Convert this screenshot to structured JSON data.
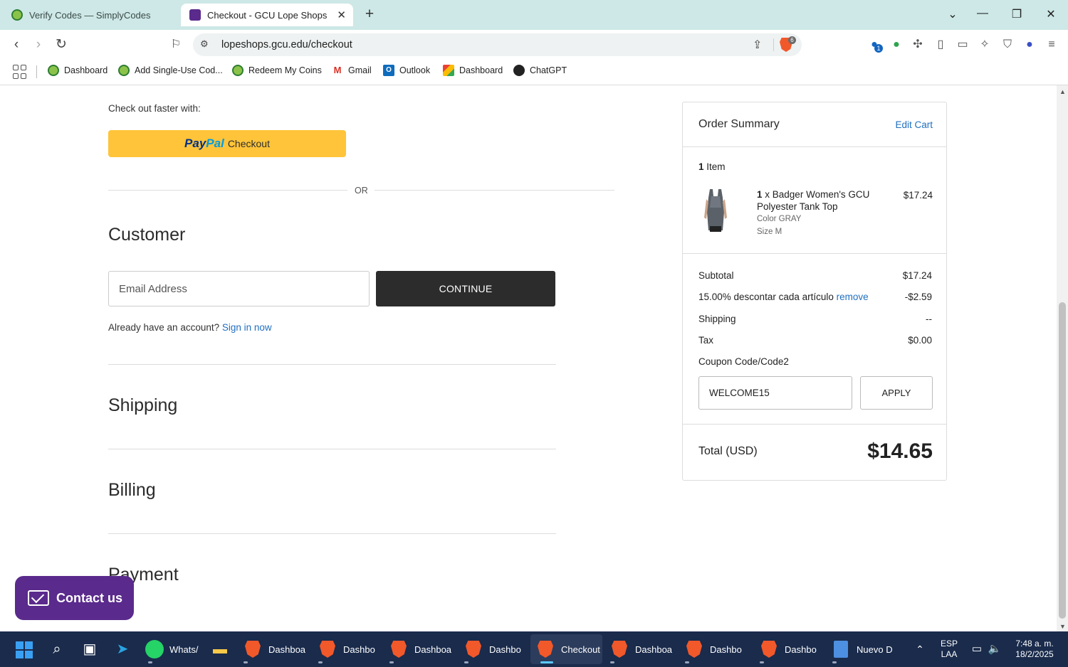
{
  "browser": {
    "tabs": [
      {
        "title": "Verify Codes — SimplyCodes",
        "active": false
      },
      {
        "title": "Checkout - GCU Lope Shops",
        "active": true
      }
    ],
    "url": "lopeshops.gcu.edu/checkout",
    "shield_count": "6",
    "ext_badge": "1",
    "bookmarks": [
      "Dashboard",
      "Add Single-Use Cod...",
      "Redeem My Coins",
      "Gmail",
      "Outlook",
      "Dashboard",
      "ChatGPT"
    ]
  },
  "checkout": {
    "faster_text": "Check out faster with:",
    "paypal_pay": "Pay",
    "paypal_pal": "Pal",
    "paypal_checkout": "Checkout",
    "or_text": "OR",
    "customer_heading": "Customer",
    "email_placeholder": "Email Address",
    "continue_label": "CONTINUE",
    "already_text": "Already have an account?",
    "sign_in_link": "Sign in now",
    "shipping_heading": "Shipping",
    "billing_heading": "Billing",
    "payment_heading": "Payment"
  },
  "summary": {
    "title": "Order Summary",
    "edit_cart": "Edit Cart",
    "item_count_num": "1",
    "item_count_label": "Item",
    "product": {
      "qty": "1",
      "name": "x Badger Women's GCU Polyester Tank Top",
      "price": "$17.24",
      "color": "Color GRAY",
      "size": "Size M"
    },
    "subtotal_label": "Subtotal",
    "subtotal_value": "$17.24",
    "discount_label": "15.00% descontar cada artículo",
    "discount_remove": "remove",
    "discount_value": "-$2.59",
    "shipping_label": "Shipping",
    "shipping_value": "--",
    "tax_label": "Tax",
    "tax_value": "$0.00",
    "coupon_link": "Coupon Code/Code2",
    "coupon_value": "WELCOME15",
    "apply_label": "APPLY",
    "total_label": "Total (USD)",
    "total_value": "$14.65"
  },
  "contact_label": "Contact us",
  "taskbar": {
    "apps": [
      "Whats/",
      "Dashboa",
      "Dashbo",
      "Dashboa",
      "Dashbo",
      "Checkout",
      "Dashboa",
      "Dashbo",
      "Dashbo",
      "Nuevo D"
    ],
    "lang_top": "ESP",
    "lang_bottom": "LAA",
    "time": "7:48 a. m.",
    "date": "18/2/2025"
  },
  "colors": {
    "accent_link": "#1f6fbf",
    "paypal_yellow": "#ffc439",
    "continue_bg": "#2c2c2c",
    "contact_purple": "#5a2a8c",
    "tabbar_bg": "#cde8e6",
    "taskbar_bg": "#1a2b4c"
  }
}
